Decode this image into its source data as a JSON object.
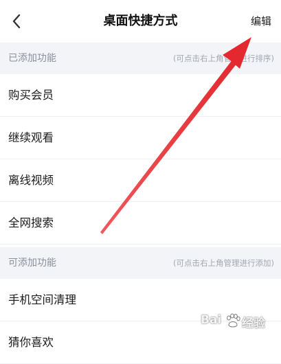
{
  "header": {
    "title": "桌面快捷方式",
    "edit_label": "编辑"
  },
  "added_section": {
    "title": "已添加功能",
    "hint": "(可点击右上角管理进行排序)",
    "items": [
      {
        "label": "购买会员"
      },
      {
        "label": "继续观看"
      },
      {
        "label": "离线视频"
      },
      {
        "label": "全网搜索"
      }
    ]
  },
  "available_section": {
    "title": "可添加功能",
    "hint": "(可点击右上角管理进行添加)",
    "items": [
      {
        "label": "手机空间清理"
      },
      {
        "label": "猜你喜欢"
      }
    ]
  },
  "watermark": {
    "brand_left": "Bai",
    "brand_right": "经验"
  },
  "colors": {
    "section_bg": "#f3f4f8",
    "annotation_arrow": "#e8373c",
    "hint_text": "#a3a7b0"
  }
}
